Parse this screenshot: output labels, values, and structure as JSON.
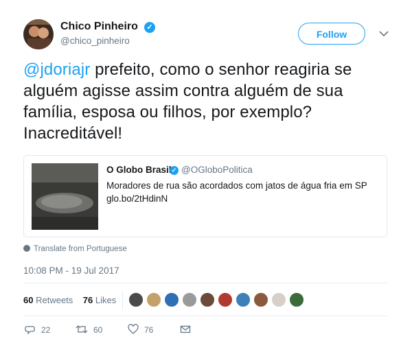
{
  "author": {
    "name": "Chico Pinheiro",
    "handle": "@chico_pinheiro",
    "follow_label": "Follow"
  },
  "tweet": {
    "mention": "@jdoriajr",
    "text": " prefeito, como o senhor reagiria se alguém agisse assim contra alguém de sua família, esposa ou filhos, por exemplo? Inacreditável!"
  },
  "quoted": {
    "name": "O Globo Brasil",
    "handle": "@OGloboPolitica",
    "text": "Moradores de rua são acordados com jatos de água fria em SP",
    "link": "glo.bo/2tHdinN"
  },
  "translate_label": "Translate from Portuguese",
  "timestamp": "10:08 PM - 19 Jul 2017",
  "stats": {
    "retweets_count": "60",
    "retweets_label": "Retweets",
    "likes_count": "76",
    "likes_label": "Likes"
  },
  "actions": {
    "replies": "22",
    "retweets": "60",
    "likes": "76"
  },
  "colors": {
    "accent": "#1da1f2",
    "secondary_text": "#657786"
  },
  "icons": [
    "verified-icon",
    "chevron-down-icon",
    "globe-icon",
    "reply-icon",
    "retweet-icon",
    "like-icon",
    "message-icon"
  ]
}
